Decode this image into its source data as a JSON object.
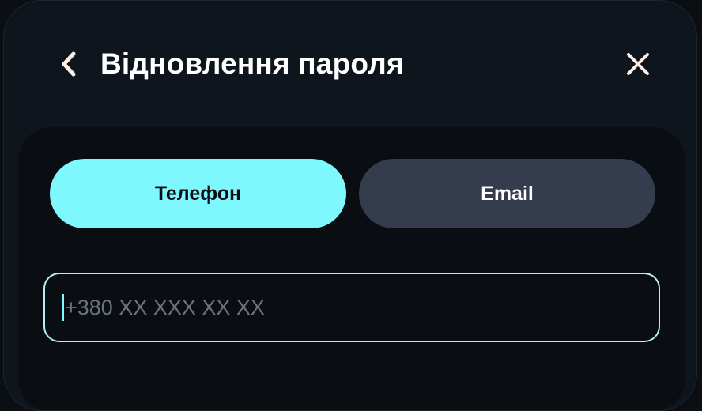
{
  "header": {
    "title": "Відновлення пароля",
    "back_icon": "chevron-left-icon",
    "close_icon": "close-icon"
  },
  "tabs": [
    {
      "label": "Телефон",
      "active": true
    },
    {
      "label": "Email",
      "active": false
    }
  ],
  "phone": {
    "value": "",
    "placeholder": "+380 XX XXX XX XX"
  },
  "colors": {
    "accent": "#7ff8fd",
    "tab_inactive": "#343c4d",
    "modal_bg": "#0e151c",
    "panel_bg": "#0a0e12",
    "placeholder": "#6b7380"
  }
}
